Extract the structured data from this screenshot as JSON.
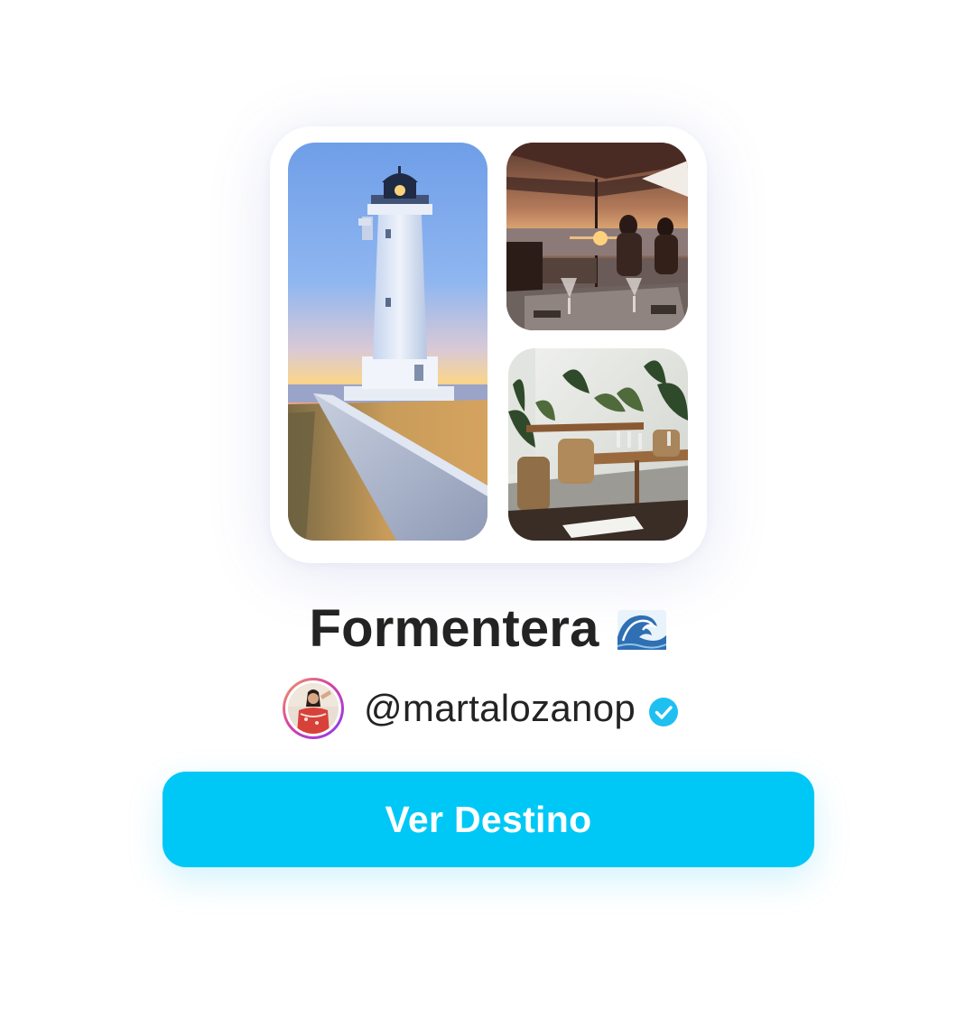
{
  "destination": {
    "title": "Formentera",
    "title_icon": "ocean-wave-emoji-icon"
  },
  "collage": {
    "photos": [
      {
        "name": "lighthouse-photo",
        "subject": "lighthouse at sunset"
      },
      {
        "name": "terrace-restaurant-photo",
        "subject": "restaurant terrace at sunset"
      },
      {
        "name": "dining-room-photo",
        "subject": "restaurant interior with plants"
      }
    ]
  },
  "author": {
    "handle": "@martalozanop",
    "verified_icon": "verified-check-icon",
    "avatar_ring_colors": [
      "#f0a15a",
      "#d63fa7",
      "#8a3cf0"
    ]
  },
  "cta": {
    "label": "Ver Destino"
  },
  "colors": {
    "accent": "#00c8f6",
    "verified": "#1ec0f0",
    "text": "#232323",
    "background": "#ffffff"
  }
}
